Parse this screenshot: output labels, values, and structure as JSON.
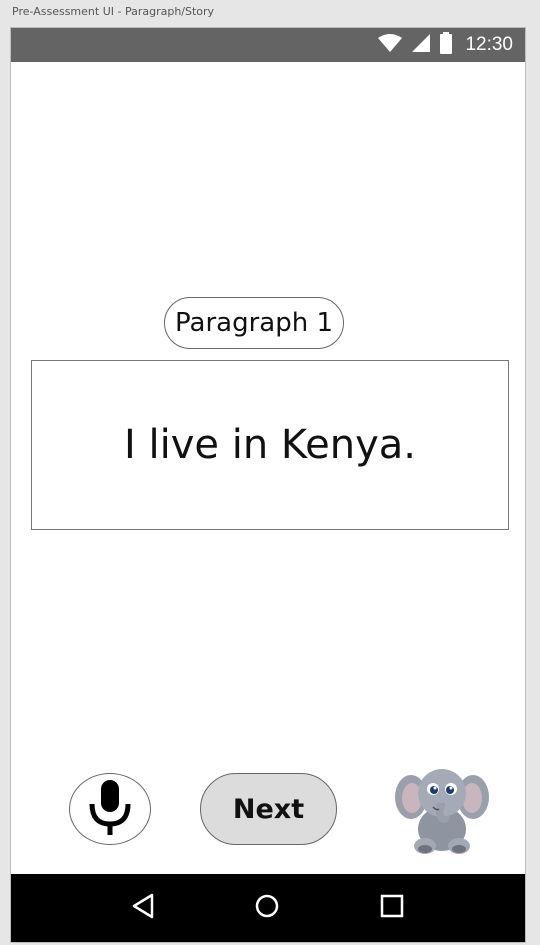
{
  "window": {
    "title": "Pre-Assessment UI - Paragraph/Story"
  },
  "status_bar": {
    "time": "12:30",
    "icons": [
      "wifi-icon",
      "signal-icon",
      "battery-icon"
    ]
  },
  "paragraph": {
    "label": "Paragraph 1",
    "text": "I live in Kenya."
  },
  "controls": {
    "mic_icon": "microphone-icon",
    "next_label": "Next",
    "mascot": "elephant-mascot"
  },
  "nav_bar": {
    "icons": [
      "back-triangle-icon",
      "home-circle-icon",
      "recents-square-icon"
    ]
  },
  "colors": {
    "status_bar": "#646464",
    "next_button_bg": "#dcdcdc",
    "nav_bar": "#000000"
  }
}
